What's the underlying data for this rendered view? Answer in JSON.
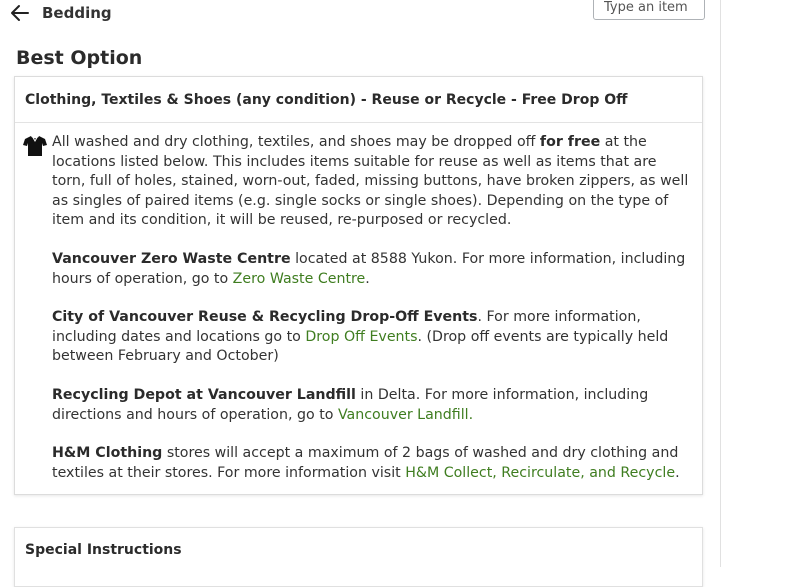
{
  "header": {
    "breadcrumb": "Bedding",
    "search_placeholder": "Type an item"
  },
  "best_option": {
    "title": "Best Option",
    "card_title": "Clothing, Textiles & Shoes (any condition) - Reuse or Recycle - Free Drop Off",
    "icon": "shirt-icon",
    "intro_pre": "All washed and dry clothing, textiles, and shoes  may be dropped off ",
    "intro_bold": "for free",
    "intro_post": " at the locations listed below.  This includes items suitable for reuse as well as items that are torn, full of holes, stained, worn-out, faded, missing buttons, have broken zippers, as well as singles of paired items (e.g. single socks or single shoes). Depending on the type of item and its condition, it will be reused, re-purposed or recycled.",
    "locations": [
      {
        "name": "Vancouver Zero Waste Centre",
        "text_pre": " located at 8588 Yukon. For more information, including hours of operation, go to ",
        "link": "Zero Waste Centre",
        "text_post": "."
      },
      {
        "name": "City of Vancouver Reuse & Recycling Drop-Off Events",
        "text_pre": ".  For more information, including dates and locations go to ",
        "link": "Drop Off Events",
        "text_post": ".  (Drop off events are typically held between February and October)"
      },
      {
        "name": "Recycling Depot at Vancouver Landfill",
        "text_pre": " in Delta. For more information, including directions and hours of operation, go to ",
        "link": "Vancouver Landfill.",
        "text_post": ""
      },
      {
        "name": "H&M Clothing",
        "text_pre": " stores will accept a maximum of 2 bags of washed and dry clothing and textiles at their stores. For more information visit ",
        "link": "H&M Collect, Recirculate, and Recycle",
        "text_post": "."
      }
    ]
  },
  "special": {
    "title": "Special Instructions"
  },
  "colors": {
    "link": "#3f7d20",
    "text": "#333333",
    "border": "#dcdcdc"
  }
}
